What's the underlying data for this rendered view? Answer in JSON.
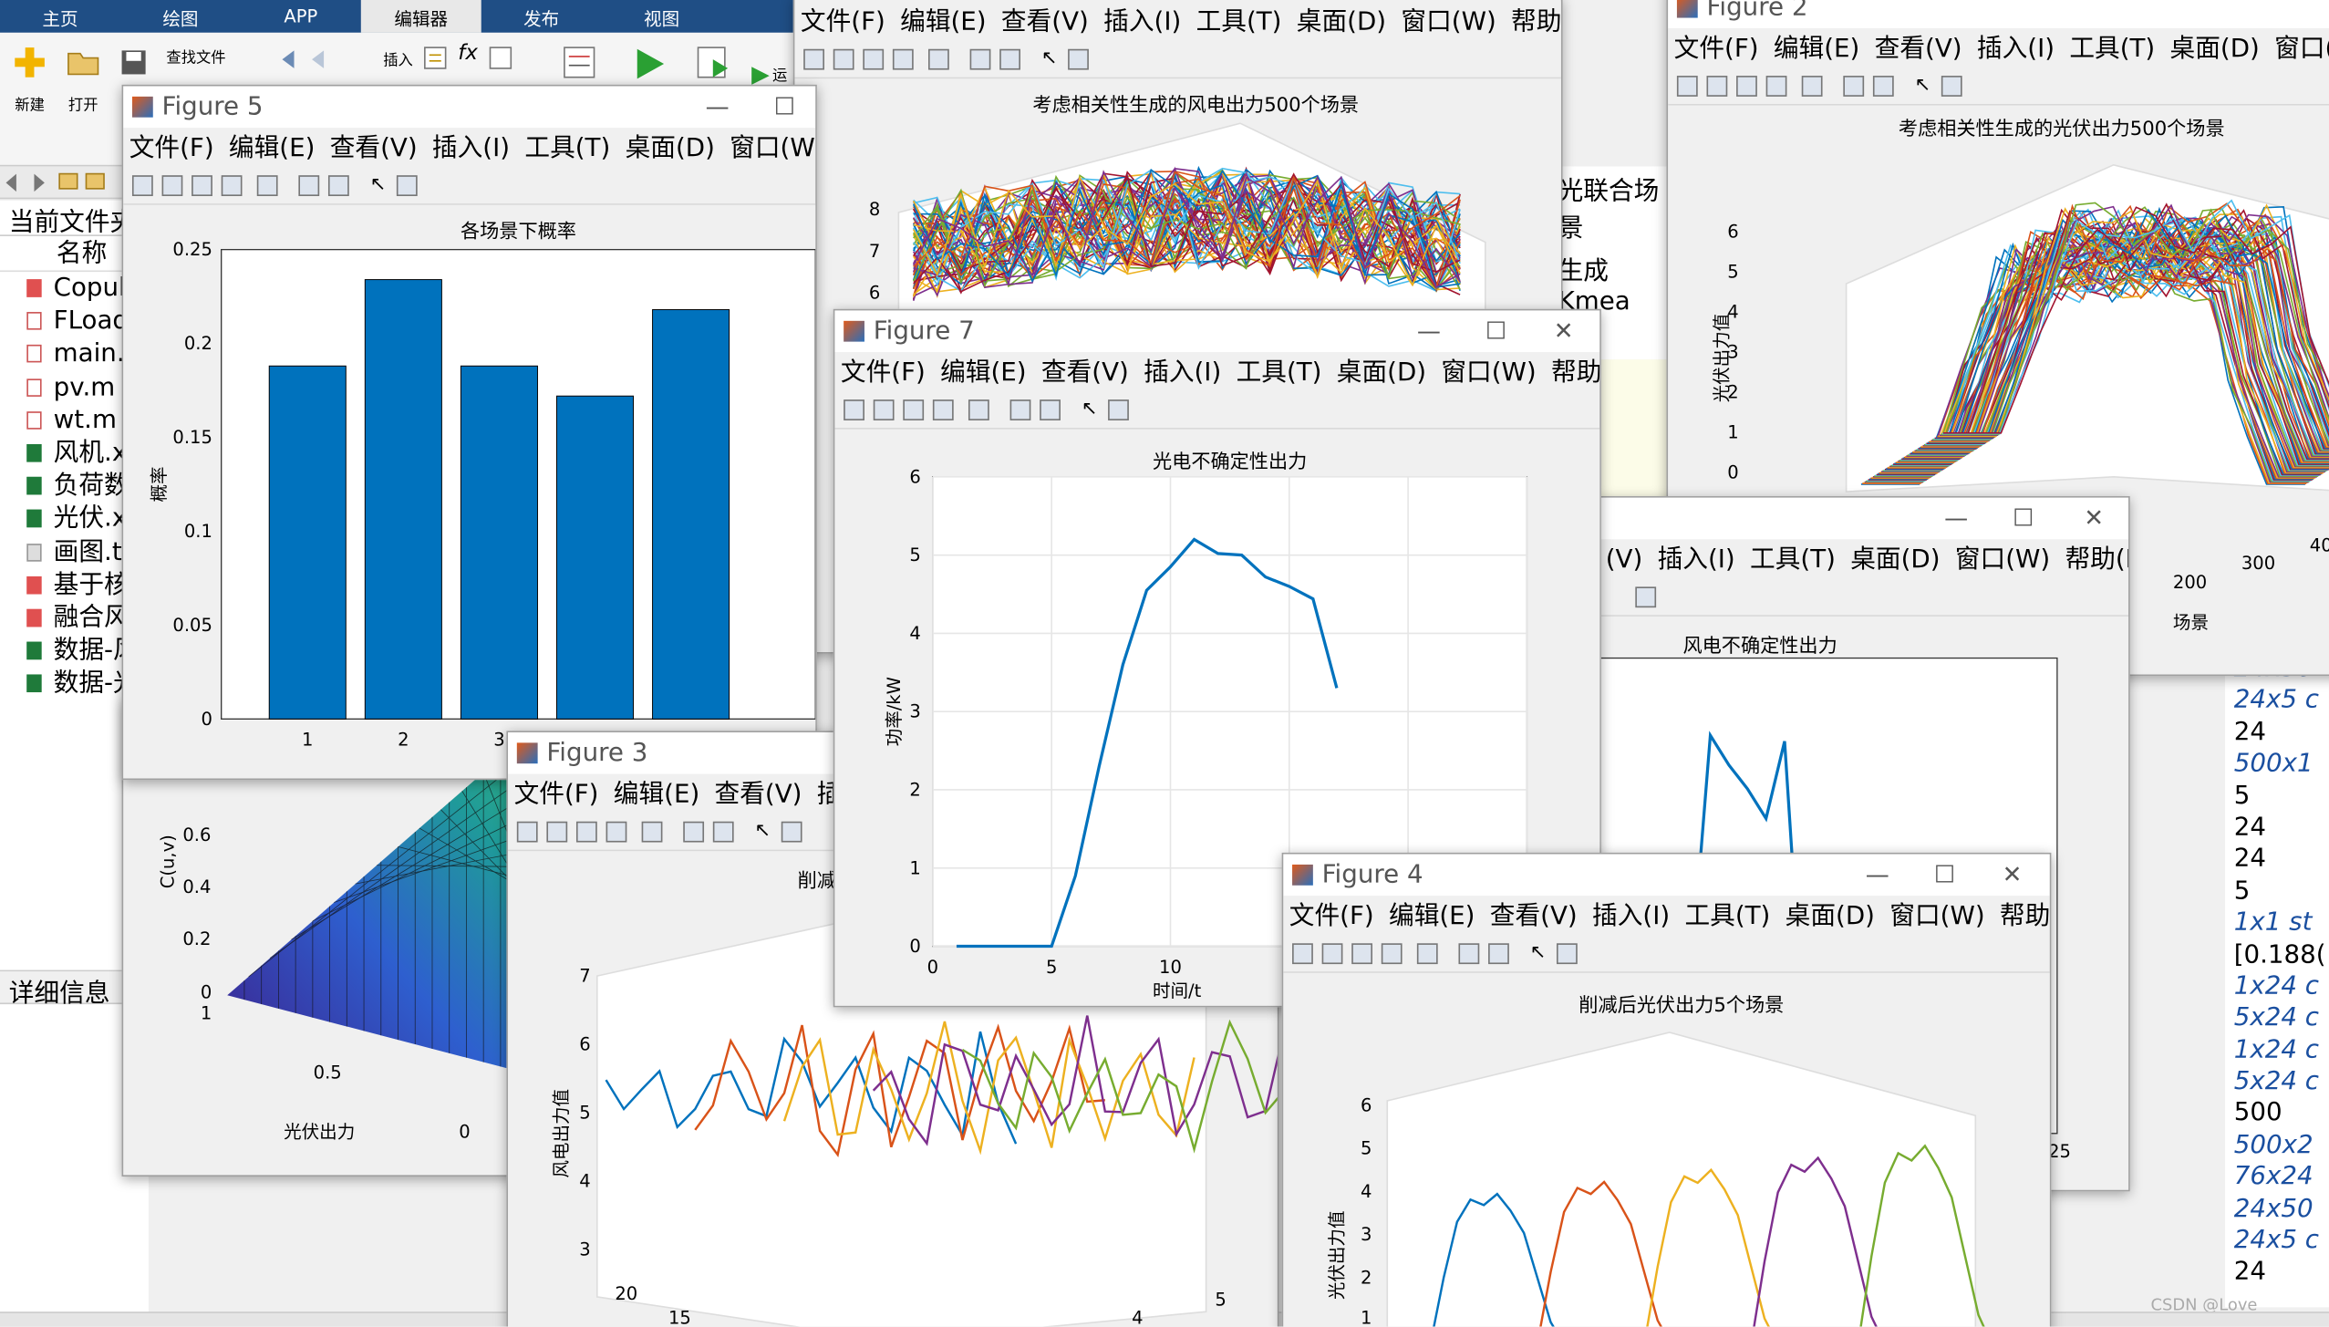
{
  "main": {
    "tabs": [
      {
        "label": "主页"
      },
      {
        "label": "绘图"
      },
      {
        "label": "APP"
      },
      {
        "label": "编辑器"
      },
      {
        "label": "发布"
      },
      {
        "label": "视图"
      }
    ],
    "ribbon": {
      "new": "新建",
      "open": "打开",
      "find_files": "查找文件",
      "insert": "插入",
      "run_label": "运"
    },
    "current_folder": "当前文件夹",
    "name_header": "名称",
    "files": [
      {
        "name": "Copul",
        "kind": "r"
      },
      {
        "name": "FLoad",
        "kind": "m"
      },
      {
        "name": "main.i",
        "kind": "m"
      },
      {
        "name": "pv.m",
        "kind": "m"
      },
      {
        "name": "wt.m",
        "kind": "m"
      },
      {
        "name": "风机.x",
        "kind": "x"
      },
      {
        "name": "负荷数",
        "kind": "x"
      },
      {
        "name": "光伏.x",
        "kind": "x"
      },
      {
        "name": "画图.t",
        "kind": "t"
      },
      {
        "name": "基于核",
        "kind": "r"
      },
      {
        "name": "融合风",
        "kind": "r"
      },
      {
        "name": "数据-风",
        "kind": "x"
      },
      {
        "name": "数据-光",
        "kind": "x"
      }
    ],
    "details_label": "详细信息",
    "editor_snippets": [
      "光联合场景",
      "生成 Kmea"
    ]
  },
  "workspace_values": [
    {
      "v": "24x50",
      "it": true
    },
    {
      "v": "24x5 c",
      "it": true
    },
    {
      "v": "24",
      "it": false
    },
    {
      "v": "500x1",
      "it": true
    },
    {
      "v": "5",
      "it": false
    },
    {
      "v": "24",
      "it": false
    },
    {
      "v": "24",
      "it": false
    },
    {
      "v": "5",
      "it": false
    },
    {
      "v": "1x1 st",
      "it": true
    },
    {
      "v": "[0.188(",
      "it": false
    },
    {
      "v": "1x24 c",
      "it": true
    },
    {
      "v": "5x24 c",
      "it": true
    },
    {
      "v": "1x24 c",
      "it": true
    },
    {
      "v": "5x24 c",
      "it": true
    },
    {
      "v": "500",
      "it": false
    },
    {
      "v": "500x2",
      "it": true
    },
    {
      "v": "76x24",
      "it": true
    },
    {
      "v": "24x50",
      "it": true
    },
    {
      "v": "24x5 c",
      "it": true
    },
    {
      "v": "24",
      "it": false
    }
  ],
  "watermark": "CSDN @Love coldplay",
  "menu_full": [
    "文件(F)",
    "编辑(E)",
    "查看(V)",
    "插入(I)",
    "工具(T)",
    "桌面(D)",
    "窗口(W)",
    "帮助(H)"
  ],
  "figures": {
    "fig2": {
      "title": "Figure 2",
      "plot_title": "考虑相关性生成的光伏出力500个场景",
      "ylabel": "光伏出力值",
      "xlabel": "场景",
      "yticks": [
        "0",
        "1",
        "2",
        "3",
        "4",
        "5",
        "6"
      ],
      "xticks": [
        "200",
        "300",
        "40"
      ]
    },
    "fig_wind500": {
      "plot_title": "考虑相关性生成的风电出力500个场景",
      "yticks": [
        "6",
        "7",
        "8"
      ]
    },
    "fig5": {
      "title": "Figure 5",
      "plot_title": "各场景下概率",
      "ylabel": "概率",
      "xlabel": "场",
      "menu_clip": "帮"
    },
    "fig_copula": {
      "zlabel": "C(u,v)",
      "xlabel": "光伏出力",
      "zticks": [
        "0",
        "0.2",
        "0.4",
        "0.6"
      ],
      "xticks": [
        "1",
        "0.5",
        "0"
      ]
    },
    "fig3": {
      "title": "Figure 3",
      "plot_title": "削减",
      "ylabel": "风电出力值",
      "yticks": [
        "3",
        "4",
        "5",
        "6",
        "7"
      ],
      "xticks": [
        "20",
        "15",
        "4",
        "5"
      ]
    },
    "fig7": {
      "title": "Figure 7",
      "plot_title": "光电不确定性出力",
      "ylabel": "功率/kW",
      "xlabel": "时间/t",
      "yticks": [
        "0",
        "1",
        "2",
        "3",
        "4",
        "5",
        "6"
      ],
      "xticks": [
        "0",
        "5",
        "10"
      ]
    },
    "fig_windunc": {
      "plot_title": "风电不确定性出力",
      "menu_clip": [
        "(V)",
        "插入(I)",
        "工具(T)",
        "桌面(D)",
        "窗口(W)",
        "帮助(H)"
      ],
      "xtick_right": "25"
    },
    "fig4": {
      "title": "Figure 4",
      "plot_title": "削减后光伏出力5个场景",
      "ylabel": "光伏出力值",
      "yticks": [
        "1",
        "2",
        "3",
        "4",
        "5",
        "6"
      ]
    }
  },
  "chart_data": [
    {
      "type": "bar",
      "title": "各场景下概率",
      "ylabel": "概率",
      "xlabel": "场景",
      "categories": [
        "1",
        "2",
        "3",
        "4",
        "5"
      ],
      "values": [
        0.188,
        0.234,
        0.188,
        0.172,
        0.218
      ],
      "ylim": [
        0,
        0.25
      ],
      "yticks": [
        0,
        0.05,
        0.1,
        0.15,
        0.2,
        0.25
      ],
      "color": "#0072bd"
    },
    {
      "type": "line",
      "title": "光电不确定性出力",
      "ylabel": "功率/kW",
      "xlabel": "时间/t",
      "x": [
        1,
        2,
        3,
        4,
        5,
        6,
        7,
        8,
        9,
        10,
        11,
        12,
        13,
        14,
        15,
        16,
        17
      ],
      "values": [
        0,
        0,
        0,
        0,
        0,
        0.9,
        2.3,
        3.6,
        4.55,
        4.85,
        5.2,
        5.02,
        5.0,
        4.72,
        4.6,
        4.44,
        3.3
      ],
      "xlim": [
        0,
        25
      ],
      "ylim": [
        0,
        6
      ],
      "color": "#0072bd"
    },
    {
      "type": "line",
      "title": "风电不确定性出力",
      "values": [
        1.6,
        2.0,
        2.1,
        0.6,
        1.1,
        3.35,
        3.1,
        2.9,
        2.65,
        3.3,
        0.9,
        0.3,
        1.45,
        1.85,
        1.55,
        1.85,
        1.6,
        2.3,
        0.7,
        0.4,
        0.8,
        1.6,
        0.9
      ],
      "color": "#0072bd"
    }
  ]
}
